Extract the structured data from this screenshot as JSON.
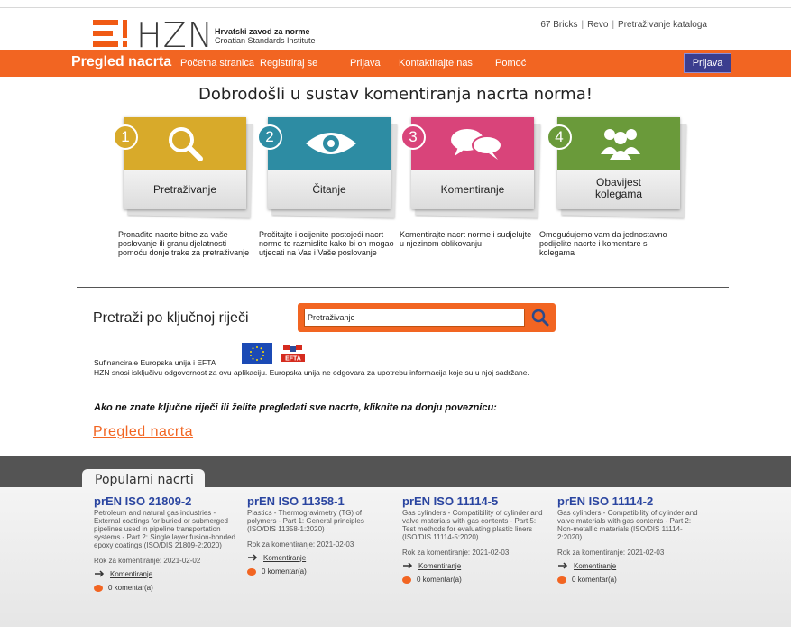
{
  "header": {
    "logo_text": "HZN",
    "org_name": "Hrvatski zavod za norme",
    "org_sub": "Croatian Standards Institute",
    "toplinks": [
      "67 Bricks",
      "Revo",
      "Pretraživanje kataloga"
    ]
  },
  "nav": {
    "brand": "Pregled nacrta",
    "items": [
      "Početna stranica",
      "Registriraj se",
      "Prijava",
      "Kontaktirajte nas",
      "Pomoć"
    ],
    "login_button": "Prijava",
    "color": "#f26522"
  },
  "welcome": "Dobrodošli u sustav komentiranja nacrta norma!",
  "steps": [
    {
      "num": "1",
      "label": "Pretraživanje",
      "icon": "magnifier-icon",
      "color": "#d8aa2a",
      "desc": "Pronađite nacrte bitne za vaše poslovanje ili granu djelatnosti pomoću donje trake za pretraživanje"
    },
    {
      "num": "2",
      "label": "Čitanje",
      "icon": "eye-icon",
      "color": "#2d8ca3",
      "desc": "Pročitajte i ocijenite postojeći nacrt norme te razmislite kako bi on mogao utjecati na Vas i Vaše poslovanje"
    },
    {
      "num": "3",
      "label": "Komentiranje",
      "icon": "speech-bubbles-icon",
      "color": "#d9447a",
      "desc": "Komentirajte nacrt norme i sudjelujte u njezinom oblikovanju"
    },
    {
      "num": "4",
      "label": "Obavijest kolegama",
      "icon": "people-icon",
      "color": "#6a9a3a",
      "desc": "Omogućujemo vam da jednostavno podijelite nacrte i komentare s kolegama"
    }
  ],
  "search": {
    "title": "Pretraži po ključnoj riječi",
    "value": "Pretraživanje"
  },
  "funding": {
    "text": "Sufinancirale Europska unija i EFTA",
    "efta_label": "EFTA",
    "disclaimer": "HZN snosi isključivu odgovornost za ovu aplikaciju. Europska unija ne odgovara za upotrebu informacija koje su u njoj sadržane."
  },
  "cta": {
    "text": "Ako ne znate ključne riječi ili želite pregledati sve nacrte, kliknite na donju poveznicu:",
    "link": "Pregled nacrta"
  },
  "popular": {
    "tab": "Popularni nacrti",
    "cards": [
      {
        "title": "prEN ISO 21809-2",
        "desc": "Petroleum and natural gas industries - External coatings for buried or submerged pipelines used in pipeline transportation systems - Part 2: Single layer fusion-bonded epoxy coatings (ISO/DIS 21809-2:2020)",
        "deadline": "Rok za komentiranje: 2021-02-02",
        "comment_link": "Komentiranje",
        "comments": "0 komentar(a)"
      },
      {
        "title": "prEN ISO 11358-1",
        "desc": "Plastics - Thermogravimetry (TG) of polymers - Part 1: General principles (ISO/DIS 11358-1:2020)",
        "deadline": "Rok za komentiranje: 2021-02-03",
        "comment_link": "Komentiranje",
        "comments": "0 komentar(a)"
      },
      {
        "title": "prEN ISO 11114-5",
        "desc": "Gas cylinders - Compatibility of cylinder and valve materials with gas contents - Part 5: Test methods for evaluating plastic liners (ISO/DIS 11114-5:2020)",
        "deadline": "Rok za komentiranje: 2021-02-03",
        "comment_link": "Komentiranje",
        "comments": "0 komentar(a)"
      },
      {
        "title": "prEN ISO 11114-2",
        "desc": "Gas cylinders - Compatibility of cylinder and valve materials with gas contents - Part 2: Non-metallic materials (ISO/DIS 11114-2:2020)",
        "deadline": "Rok za komentiranje: 2021-02-03",
        "comment_link": "Komentiranje",
        "comments": "0 komentar(a)"
      }
    ]
  }
}
